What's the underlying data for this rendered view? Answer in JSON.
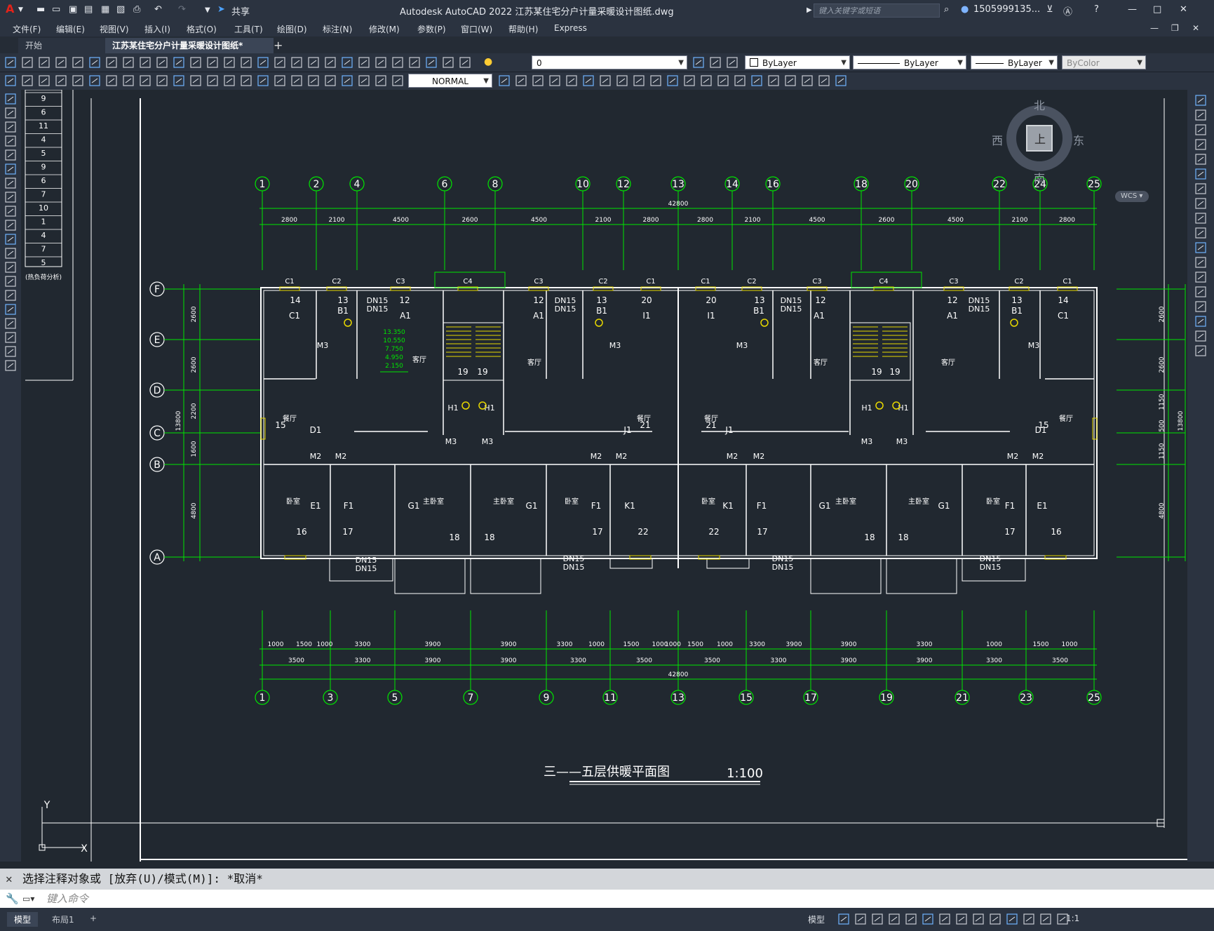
{
  "app": {
    "title": "Autodesk AutoCAD 2022    江苏某住宅分户计量采暖设计图纸.dwg",
    "search_placeholder": "键入关键字或短语",
    "user": "1505999135...",
    "share": "共享"
  },
  "menu": [
    "文件(F)",
    "编辑(E)",
    "视图(V)",
    "插入(I)",
    "格式(O)",
    "工具(T)",
    "绘图(D)",
    "标注(N)",
    "修改(M)",
    "参数(P)",
    "窗口(W)",
    "帮助(H)",
    "Express"
  ],
  "tabs": {
    "start": "开始",
    "active": "江苏某住宅分户计量采暖设计图纸*",
    "add": "+"
  },
  "toolbar": {
    "layer_value": "0",
    "color": "ByLayer",
    "linetype": "ByLayer",
    "lineweight": "ByLayer",
    "plotstyle": "ByColor",
    "textstyle": "NORMAL"
  },
  "viewcube": {
    "north": "北",
    "south": "南",
    "east": "东",
    "west": "西",
    "face": "上",
    "wcs": "WCS"
  },
  "drawing": {
    "legend_numbers": [
      "9",
      "6",
      "11",
      "4",
      "5",
      "9",
      "6",
      "7",
      "10",
      "1",
      "4",
      "7",
      "5"
    ],
    "legend_text": "(热负荷分析)",
    "top_axes": [
      "1",
      "2",
      "4",
      "6",
      "8",
      "10",
      "12",
      "13",
      "14",
      "16",
      "18",
      "20",
      "22",
      "24",
      "25"
    ],
    "bottom_axes": [
      "1",
      "3",
      "5",
      "7",
      "9",
      "11",
      "13",
      "15",
      "17",
      "19",
      "21",
      "23",
      "25"
    ],
    "row_axes": [
      "F",
      "E",
      "D",
      "C",
      "B",
      "A"
    ],
    "total_dim": "42800",
    "top_dims": [
      "2800",
      "2100",
      "4500",
      "2600",
      "4500",
      "2100",
      "2800",
      "2800",
      "2100",
      "4500",
      "2600",
      "4500",
      "2100",
      "2800"
    ],
    "bottom_dims_1": [
      "1000",
      "1500",
      "1000",
      "3300",
      "3900",
      "3900",
      "3300",
      "1000",
      "1500",
      "1000",
      "1000",
      "1500",
      "1000",
      "3300",
      "3900",
      "3900",
      "3300",
      "1000",
      "1500",
      "1000"
    ],
    "bottom_dims_2": [
      "3500",
      "3300",
      "3900",
      "3900",
      "3300",
      "3500",
      "3500",
      "3300",
      "3900",
      "3900",
      "3300",
      "3500"
    ],
    "left_dims": [
      "2600",
      "2600",
      "2200",
      "1600",
      "4800"
    ],
    "left_total": "13800",
    "right_dims": [
      "2600",
      "2600",
      "1150",
      "500",
      "1150",
      "4800"
    ],
    "right_total": "13800",
    "elevations": [
      "13.350",
      "10.550",
      "7.750",
      "4.950",
      "2.150"
    ],
    "window_labels": [
      "C1",
      "C2",
      "C3",
      "C4",
      "C3",
      "C2",
      "C1",
      "C1",
      "C2",
      "C3",
      "C4",
      "C3",
      "C2",
      "C1"
    ],
    "title": "三——五层供暖平面图",
    "scale": "1:100",
    "rooms": {
      "living": "客厅",
      "dining": "餐厅",
      "bedroom": "卧室",
      "master": "主卧室"
    }
  },
  "command": {
    "history": "选择注释对象或 [放弃(U)/模式(M)]: *取消*",
    "placeholder": "键入命令"
  },
  "status": {
    "tab_model": "模型",
    "tab_layout": "布局1",
    "model": "模型",
    "scale": "1:1"
  },
  "colors": {
    "background": "#212830",
    "lines": "#ffffff",
    "dims": "#00e600",
    "pipes": "#e8d800"
  }
}
